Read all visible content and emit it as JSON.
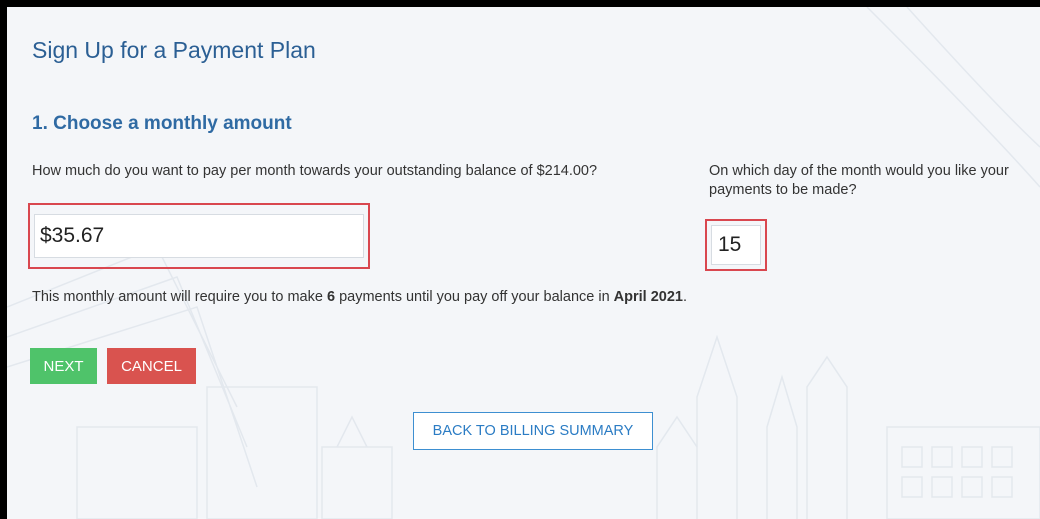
{
  "page": {
    "title": "Sign Up for a Payment Plan",
    "step_title": "1. Choose a monthly amount"
  },
  "amount": {
    "question_prefix": "How much do you want to pay per month towards your outstanding balance of ",
    "balance": "$214.00",
    "question_suffix": "?",
    "value": "$35.67"
  },
  "day": {
    "question": "On which day of the month would you like your payments to be made?",
    "value": "15"
  },
  "summary": {
    "prefix": "This monthly amount will require you to make ",
    "payments_count": "6",
    "middle": " payments until you pay off your balance in ",
    "end_date": "April 2021",
    "suffix": "."
  },
  "buttons": {
    "next": "NEXT",
    "cancel": "CANCEL",
    "back": "BACK TO BILLING SUMMARY"
  },
  "colors": {
    "title": "#2b5f94",
    "next": "#4fc36a",
    "cancel": "#d9534f",
    "highlight": "#d9474f",
    "link": "#2b7cc4"
  }
}
